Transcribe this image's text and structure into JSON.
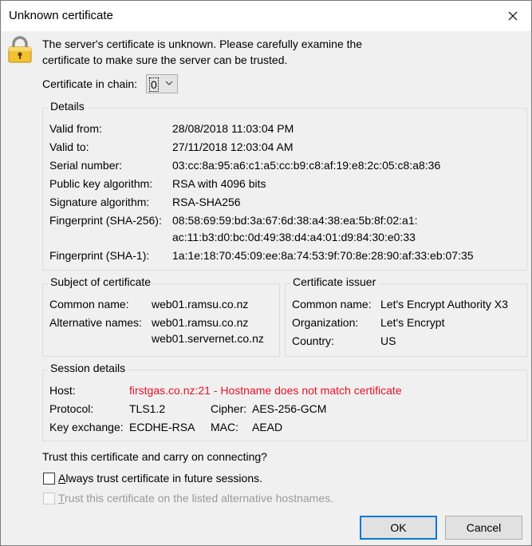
{
  "window": {
    "title": "Unknown certificate"
  },
  "header": {
    "icon": "lock-icon",
    "message_line1": "The server's certificate is unknown. Please carefully examine the",
    "message_line2": "certificate to make sure the server can be trusted."
  },
  "chain": {
    "label": "Certificate in chain:",
    "selected": "0"
  },
  "details": {
    "title": "Details",
    "valid_from_label": "Valid from:",
    "valid_from": "28/08/2018 11:03:04 PM",
    "valid_to_label": "Valid to:",
    "valid_to": "27/11/2018 12:03:04 AM",
    "serial_label": "Serial number:",
    "serial": "03:cc:8a:95:a6:c1:a5:cc:b9:c8:af:19:e8:2c:05:c8:a8:36",
    "pubkey_label": "Public key algorithm:",
    "pubkey": "RSA with 4096 bits",
    "sigalg_label": "Signature algorithm:",
    "sigalg": "RSA-SHA256",
    "sha256_label": "Fingerprint (SHA-256):",
    "sha256_line1": "08:58:69:59:bd:3a:67:6d:38:a4:38:ea:5b:8f:02:a1:",
    "sha256_line2": "ac:11:b3:d0:bc:0d:49:38:d4:a4:01:d9:84:30:e0:33",
    "sha1_label": "Fingerprint (SHA-1):",
    "sha1": "1a:1e:18:70:45:09:ee:8a:74:53:9f:70:8e:28:90:af:33:eb:07:35"
  },
  "subject": {
    "title": "Subject of certificate",
    "cn_label": "Common name:",
    "cn": "web01.ramsu.co.nz",
    "alt_label": "Alternative names:",
    "alt1": "web01.ramsu.co.nz",
    "alt2": "web01.servernet.co.nz"
  },
  "issuer": {
    "title": "Certificate issuer",
    "cn_label": "Common name:",
    "cn": "Let's Encrypt Authority X3",
    "org_label": "Organization:",
    "org": "Let's Encrypt",
    "country_label": "Country:",
    "country": "US"
  },
  "session": {
    "title": "Session details",
    "host_label": "Host:",
    "host": "firstgas.co.nz:21 - Hostname does not match certificate",
    "protocol_label": "Protocol:",
    "protocol": "TLS1.2",
    "cipher_label": "Cipher:",
    "cipher": "AES-256-GCM",
    "kex_label": "Key exchange:",
    "kex": "ECDHE-RSA",
    "mac_label": "MAC:",
    "mac": "AEAD",
    "colors": {
      "error": "#e81123"
    }
  },
  "trust": {
    "prompt": "Trust this certificate and carry on connecting?",
    "always_a": "A",
    "always_rest": "lways trust certificate in future sessions.",
    "always_checked": false,
    "alt_t": "T",
    "alt_rest": "rust this certificate on the listed alternative hostnames.",
    "alt_checked": false,
    "alt_enabled": false
  },
  "buttons": {
    "ok": "OK",
    "cancel": "Cancel"
  }
}
